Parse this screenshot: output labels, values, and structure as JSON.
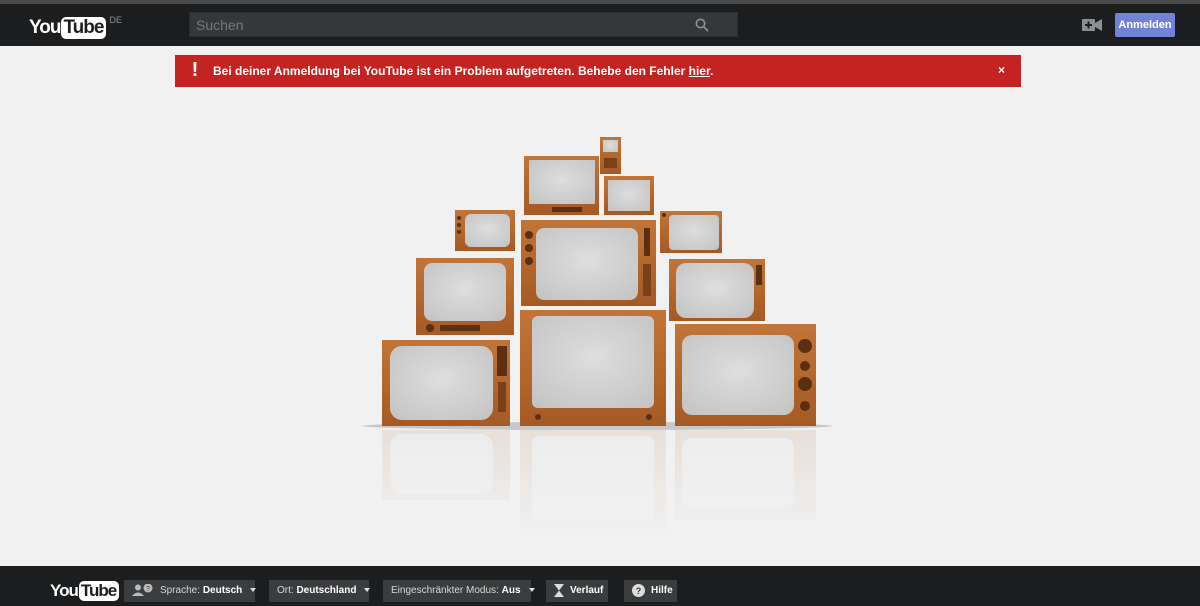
{
  "masthead": {
    "logo": {
      "you": "You",
      "tube": "Tube",
      "country": "DE"
    },
    "search": {
      "placeholder": "Suchen"
    },
    "icons": {
      "search": "search-icon",
      "upload": "video-camera-plus-icon"
    },
    "signin_label": "Anmelden"
  },
  "alert": {
    "icon": "!",
    "message": "Bei deiner Anmeldung bei YouTube ist ein Problem aufgetreten. Behebe den Fehler ",
    "link_label": "hier",
    "message_end": ".",
    "close_label": "×"
  },
  "illustration": {
    "name": "tv-stack-illustration"
  },
  "footer": {
    "logo": {
      "you": "You",
      "tube": "Tube"
    },
    "language": {
      "label": "Sprache: ",
      "value": "Deutsch"
    },
    "location": {
      "label": "Ort: ",
      "value": "Deutschland"
    },
    "restricted": {
      "label": "Eingeschränkter Modus: ",
      "value": "Aus"
    },
    "history_label": "Verlauf",
    "help_label": "Hilfe"
  },
  "colors": {
    "masthead_bg": "#1b1d1f",
    "alert_bg": "#c42421",
    "signin_bg": "#7083d6",
    "page_bg": "#f1f1f1",
    "wood": "#b5642c"
  }
}
